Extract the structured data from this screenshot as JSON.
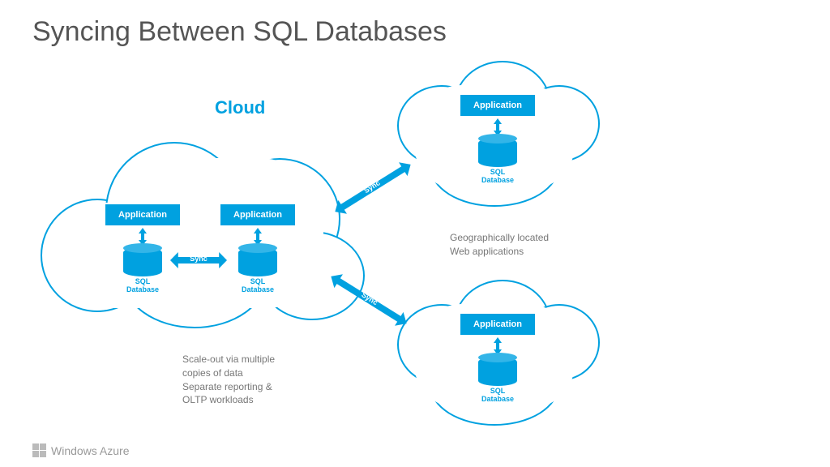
{
  "title": "Syncing Between SQL Databases",
  "cloud_heading": "Cloud",
  "app_label": "Application",
  "db_label_line1": "SQL",
  "db_label_line2": "Database",
  "sync_label": "Sync",
  "caption_right_line1": "Geographically located",
  "caption_right_line2": "Web applications",
  "caption_bottom_line1": "Scale-out via multiple",
  "caption_bottom_line2": "copies of data",
  "caption_bottom_line3": "Separate reporting &",
  "caption_bottom_line4": "OLTP workloads",
  "footer_brand": "Windows Azure",
  "colors": {
    "accent": "#00a1e0",
    "text": "#555"
  }
}
